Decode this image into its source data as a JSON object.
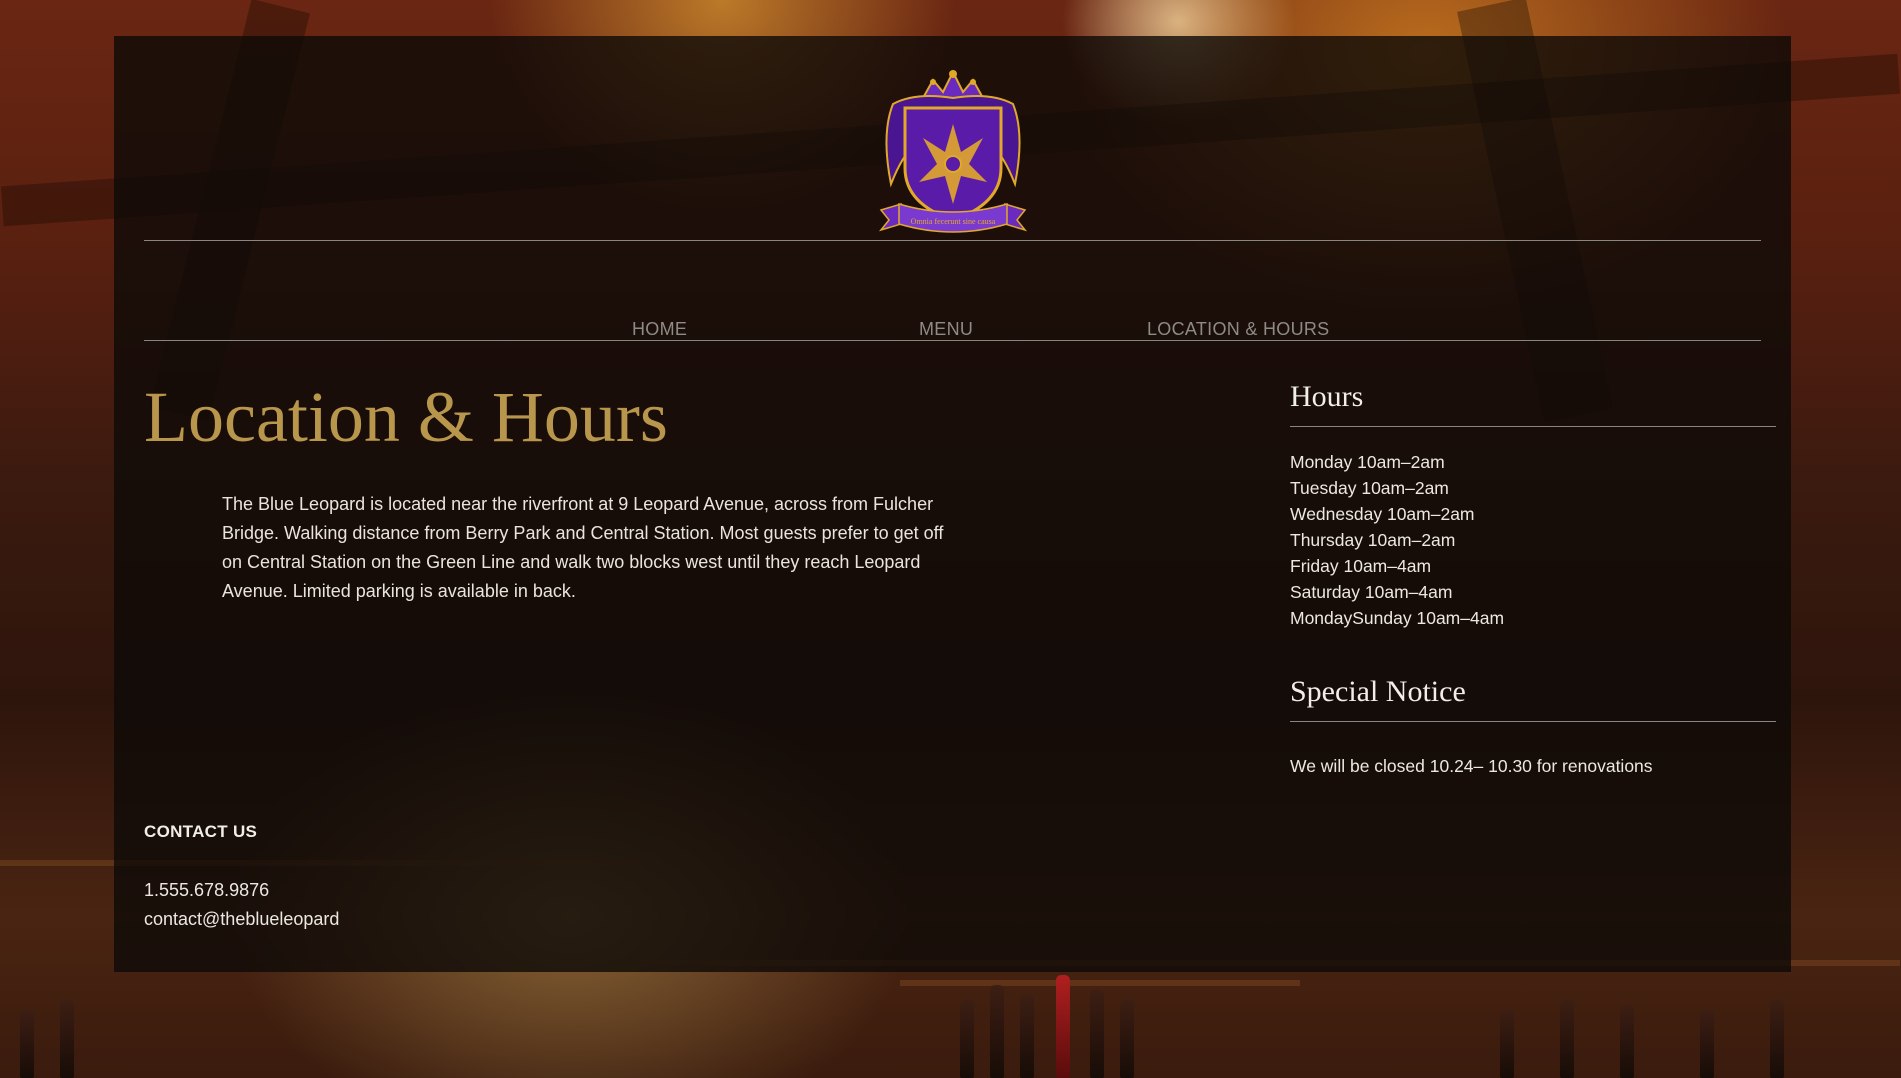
{
  "brand": {
    "logo_motto": "Omnia fecerunt sine causa"
  },
  "nav": {
    "items": [
      {
        "label": "HOME"
      },
      {
        "label": "MENU"
      },
      {
        "label": "LOCATION & HOURS"
      }
    ]
  },
  "main": {
    "title": "Location & Hours",
    "intro": "The Blue Leopard is located near the riverfront at 9 Leopard Avenue, across from Fulcher Bridge. Walking distance from Berry Park and Central Station. Most guests prefer to get off on Central Station on the Green Line and walk two blocks west until they reach Leopard Avenue. Limited parking is available in back."
  },
  "hours": {
    "heading": "Hours",
    "items": [
      "Monday 10am–2am",
      "Tuesday 10am–2am",
      "Wednesday 10am–2am",
      "Thursday 10am–2am",
      "Friday 10am–4am",
      "Saturday 10am–4am",
      "MondaySunday 10am–4am"
    ]
  },
  "notice": {
    "heading": "Special Notice",
    "text": "We will be closed 10.24– 10.30 for renovations"
  },
  "contact": {
    "heading": "CONTACT US",
    "phone": "1.555.678.9876",
    "email": "contact@theblueleopard"
  },
  "colors": {
    "accent_gold": "#b8964c",
    "crest_purple": "#5a1ca8",
    "crest_gold": "#e0a92a",
    "nav_text": "#8e8a86"
  }
}
